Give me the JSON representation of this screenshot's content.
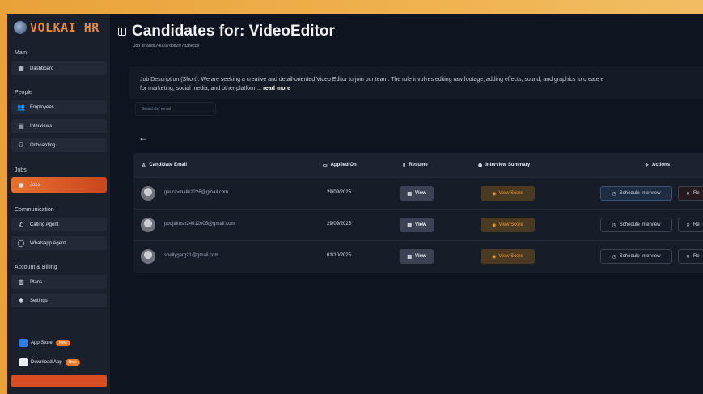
{
  "brand": {
    "name": "VOLKAI HR"
  },
  "sidebar": {
    "sections": {
      "main": "Main",
      "people": "People",
      "jobs": "Jobs",
      "communication": "Communication",
      "account": "Account & Billing"
    },
    "items": {
      "dashboard": "Dashboard",
      "employees": "Employees",
      "interviews": "Interviews",
      "onboarding": "Onboarding",
      "jobs": "Jobs",
      "calling_agent": "Calling Agent",
      "whatsapp_agent": "Whatsapp Agent",
      "plans": "Plans",
      "settings": "Settings"
    },
    "promos": {
      "app_store": "App Store",
      "download_app": "Download App",
      "badge": "New"
    }
  },
  "header": {
    "title": "Candidates for: VideoEditor",
    "job_id": "Job Id: 68da740017dbd2f77d38ecd9"
  },
  "description": {
    "line1": "Job Description (Short): We are seeking a creative and detail-oriented Video Editor to join our team. The role involves editing raw footage, adding effects, sound, and graphics to create e",
    "line2": "for marketing, social media, and other platform...",
    "read_more": "read more"
  },
  "search": {
    "placeholder": "Search by email"
  },
  "table": {
    "headers": {
      "email": "Candidate Email",
      "applied": "Applied On",
      "resume": "Resume",
      "summary": "Interview Summary",
      "actions": "Actions"
    },
    "rows": [
      {
        "email": "gauravmalik2226@gmail.com",
        "applied": "29/09/2025",
        "view": "View",
        "score": "View Score",
        "schedule": "Schedule Interview",
        "reject": "Re"
      },
      {
        "email": "poojakush24012005@gmail.com",
        "applied": "29/09/2025",
        "view": "View",
        "score": "View Score",
        "schedule": "Schedule Interview",
        "reject": "Re"
      },
      {
        "email": "shellygarg21@gmail.com",
        "applied": "01/10/2025",
        "view": "View",
        "score": "View Score",
        "schedule": "Schedule Interview",
        "reject": "Re"
      }
    ]
  },
  "colors": {
    "accent": "#e8702c",
    "background": "#0f1520",
    "sidebar": "#1a202c"
  }
}
